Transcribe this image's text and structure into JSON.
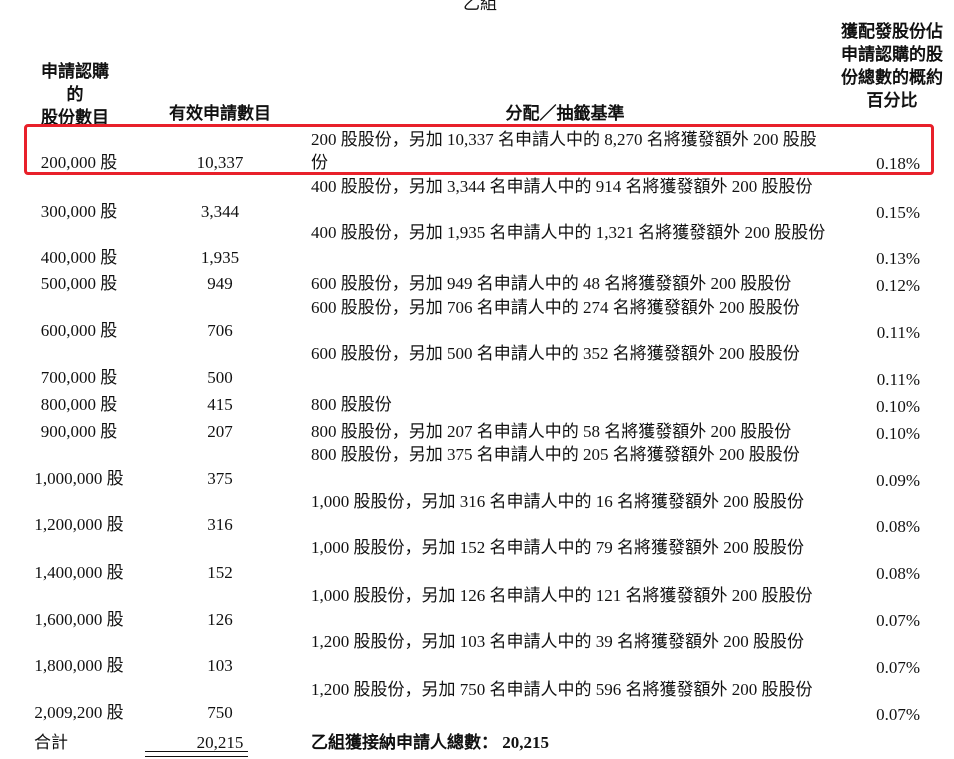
{
  "group_title": "乙組",
  "headers": {
    "shares_applied": [
      "申請認購",
      "的",
      "股份數目"
    ],
    "valid_applications": "有效申請數目",
    "basis_of_allocation": "分配／抽籤基準",
    "approx_percentage": [
      "獲配發股份佔",
      "申請認購的股",
      "份總數的概約",
      "百分比"
    ]
  },
  "rows": [
    {
      "shares": "200,000 股",
      "apps": "10,337",
      "basis": "200 股股份，另加 10,337 名申請人中的 8,270 名將獲發額外 200 股股份",
      "pct": "0.18%"
    },
    {
      "shares": "300,000 股",
      "apps": "3,344",
      "basis": "400 股股份，另加 3,344 名申請人中的 914 名將獲發額外 200 股股份",
      "pct": "0.15%"
    },
    {
      "shares": "400,000 股",
      "apps": "1,935",
      "basis": "400 股股份，另加 1,935 名申請人中的 1,321 名將獲發額外 200 股股份",
      "pct": "0.13%"
    },
    {
      "shares": "500,000 股",
      "apps": "949",
      "basis": "600 股股份，另加 949 名申請人中的 48 名將獲發額外 200 股股份",
      "pct": "0.12%"
    },
    {
      "shares": "600,000 股",
      "apps": "706",
      "basis": "600 股股份，另加 706 名申請人中的 274 名將獲發額外 200 股股份",
      "pct": "0.11%"
    },
    {
      "shares": "700,000 股",
      "apps": "500",
      "basis": "600 股股份，另加 500 名申請人中的 352 名將獲發額外 200 股股份",
      "pct": "0.11%"
    },
    {
      "shares": "800,000 股",
      "apps": "415",
      "basis": "800 股股份",
      "pct": "0.10%"
    },
    {
      "shares": "900,000 股",
      "apps": "207",
      "basis": "800 股股份，另加 207 名申請人中的 58 名將獲發額外 200 股股份",
      "pct": "0.10%"
    },
    {
      "shares": "1,000,000 股",
      "apps": "375",
      "basis": "800 股股份，另加 375 名申請人中的 205 名將獲發額外 200 股股份",
      "pct": "0.09%"
    },
    {
      "shares": "1,200,000 股",
      "apps": "316",
      "basis": "1,000 股股份，另加 316 名申請人中的 16 名將獲發額外 200 股股份",
      "pct": "0.08%"
    },
    {
      "shares": "1,400,000 股",
      "apps": "152",
      "basis": "1,000 股股份，另加 152 名申請人中的 79 名將獲發額外 200 股股份",
      "pct": "0.08%"
    },
    {
      "shares": "1,600,000 股",
      "apps": "126",
      "basis": "1,000 股股份，另加 126 名申請人中的 121 名將獲發額外 200 股股份",
      "pct": "0.07%"
    },
    {
      "shares": "1,800,000 股",
      "apps": "103",
      "basis": "1,200 股股份，另加 103 名申請人中的 39 名將獲發額外 200 股股份",
      "pct": "0.07%"
    },
    {
      "shares": "2,009,200 股",
      "apps": "750",
      "basis": "1,200 股股份，另加 750 名申請人中的 596 名將獲發額外 200 股股份",
      "pct": "0.07%"
    }
  ],
  "total": {
    "label": "合計",
    "apps": "20,215",
    "summary_label": "乙組獲接納申請人總數：",
    "summary_value": "20,215"
  },
  "highlight_color": "#e8202a"
}
